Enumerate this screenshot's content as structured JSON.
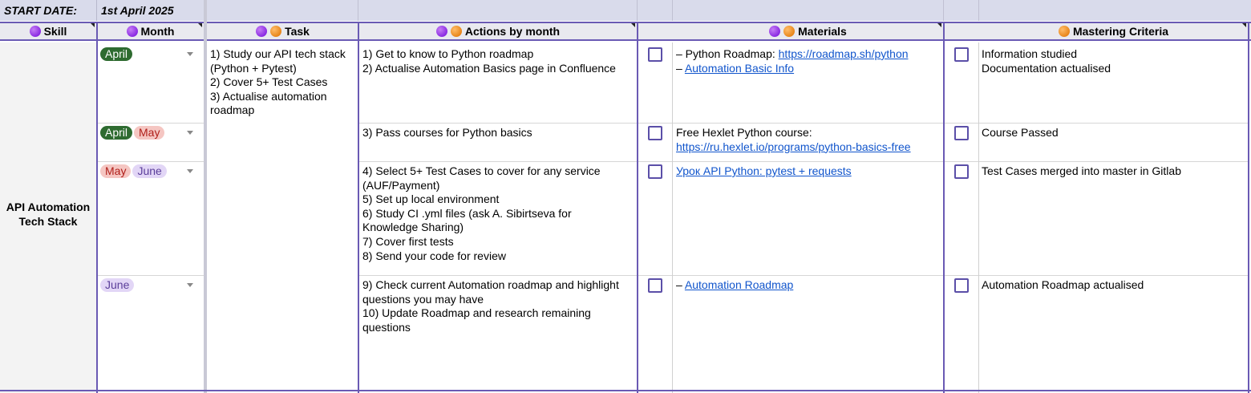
{
  "top": {
    "start_label": "START DATE:",
    "start_value": "1st April 2025"
  },
  "headers": {
    "skill": "Skill",
    "month": "Month",
    "task": "Task",
    "actions": "Actions by month",
    "materials": "Materials",
    "criteria": "Mastering Criteria"
  },
  "skill": "API Automation\nTech Stack",
  "task": "1) Study our API tech stack\n(Python + Pytest)\n2) Cover 5+ Test Cases\n3) Actualise automation\nroadmap",
  "rows": [
    {
      "months": [
        "April"
      ],
      "actions": "1) Get to know to Python roadmap\n2) Actualise Automation Basics page in Confluence",
      "materials": {
        "line1_prefix": "– Python Roadmap: ",
        "line1_link": "https://roadmap.sh/python",
        "line2_prefix": "– ",
        "line2_link": "Automation Basic Info"
      },
      "criteria": "Information studied\nDocumentation actualised"
    },
    {
      "months": [
        "April",
        "May"
      ],
      "actions": "3) Pass courses for Python basics",
      "materials": {
        "line1_prefix": "Free Hexlet Python course:",
        "line2_link": "https://ru.hexlet.io/programs/python-basics-free"
      },
      "criteria": "Course Passed"
    },
    {
      "months": [
        "May",
        "June"
      ],
      "actions": "4) Select 5+ Test Cases to cover for any service\n(AUF/Payment)\n5) Set up local environment\n6) Study CI .yml files (ask A. Sibirtseva for\nKnowledge Sharing)\n7) Cover first tests\n8) Send your code for review",
      "materials": {
        "line1_link": "Урок API Python: pytest + requests"
      },
      "criteria": "Test Cases merged into master in Gitlab"
    },
    {
      "months": [
        "June"
      ],
      "actions": "9) Check current Automation roadmap and highlight\nquestions you may have\n10) Update Roadmap and research remaining\nquestions",
      "materials": {
        "line1_prefix": "– ",
        "line1_link": "Automation Roadmap"
      },
      "criteria": "Automation Roadmap actualised"
    }
  ],
  "colors": {
    "accent": "#6a5ab4",
    "april": "#2e6b30",
    "may": "#f5c6c2",
    "june": "#e2d6f6",
    "link": "#1155cc"
  },
  "icons": [
    "purple-circle-icon",
    "orange-circle-icon",
    "checkbox-icon",
    "dropdown-arrow-icon"
  ]
}
